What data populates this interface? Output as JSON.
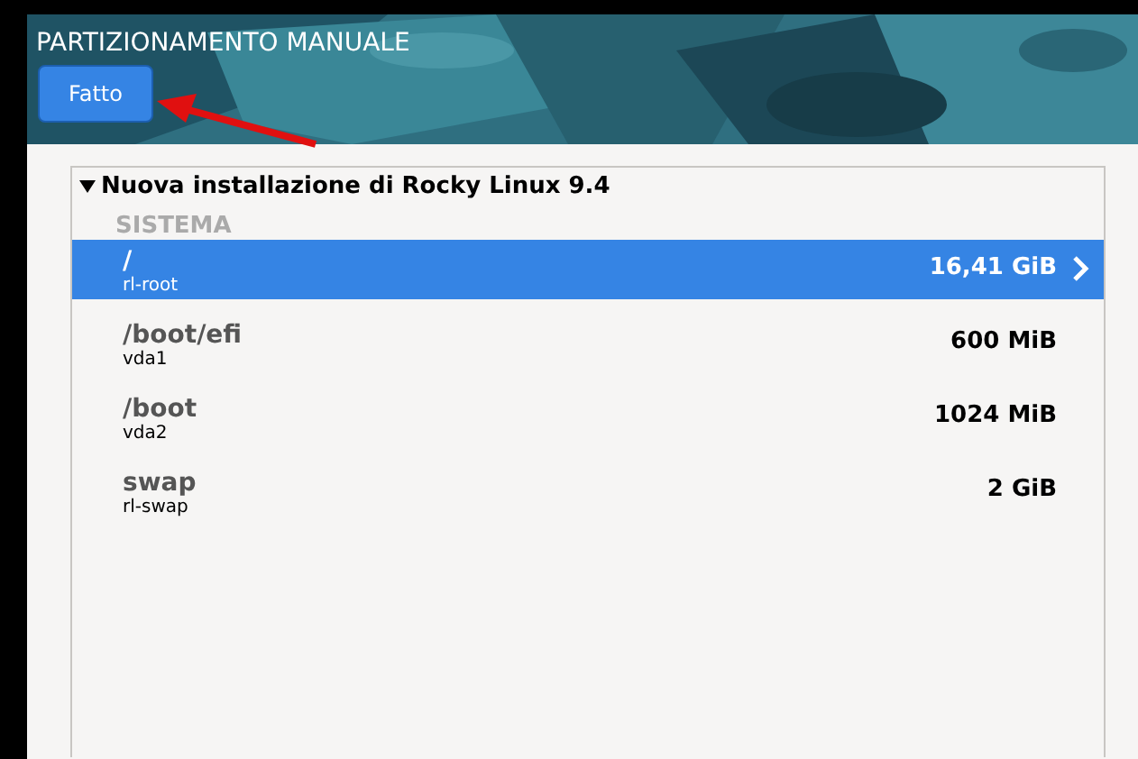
{
  "header": {
    "title": "PARTIZIONAMENTO MANUALE",
    "done_button": "Fatto"
  },
  "installation": {
    "title": "Nuova installazione di Rocky Linux 9.4",
    "expanded": true,
    "group": "SISTEMA",
    "mounts": [
      {
        "mount": "/",
        "device": "rl-root",
        "size": "16,41 GiB",
        "selected": true
      },
      {
        "mount": "/boot/efi",
        "device": "vda1",
        "size": "600 MiB",
        "selected": false
      },
      {
        "mount": "/boot",
        "device": "vda2",
        "size": "1024 MiB",
        "selected": false
      },
      {
        "mount": "swap",
        "device": "rl-swap",
        "size": "2 GiB",
        "selected": false
      }
    ]
  }
}
